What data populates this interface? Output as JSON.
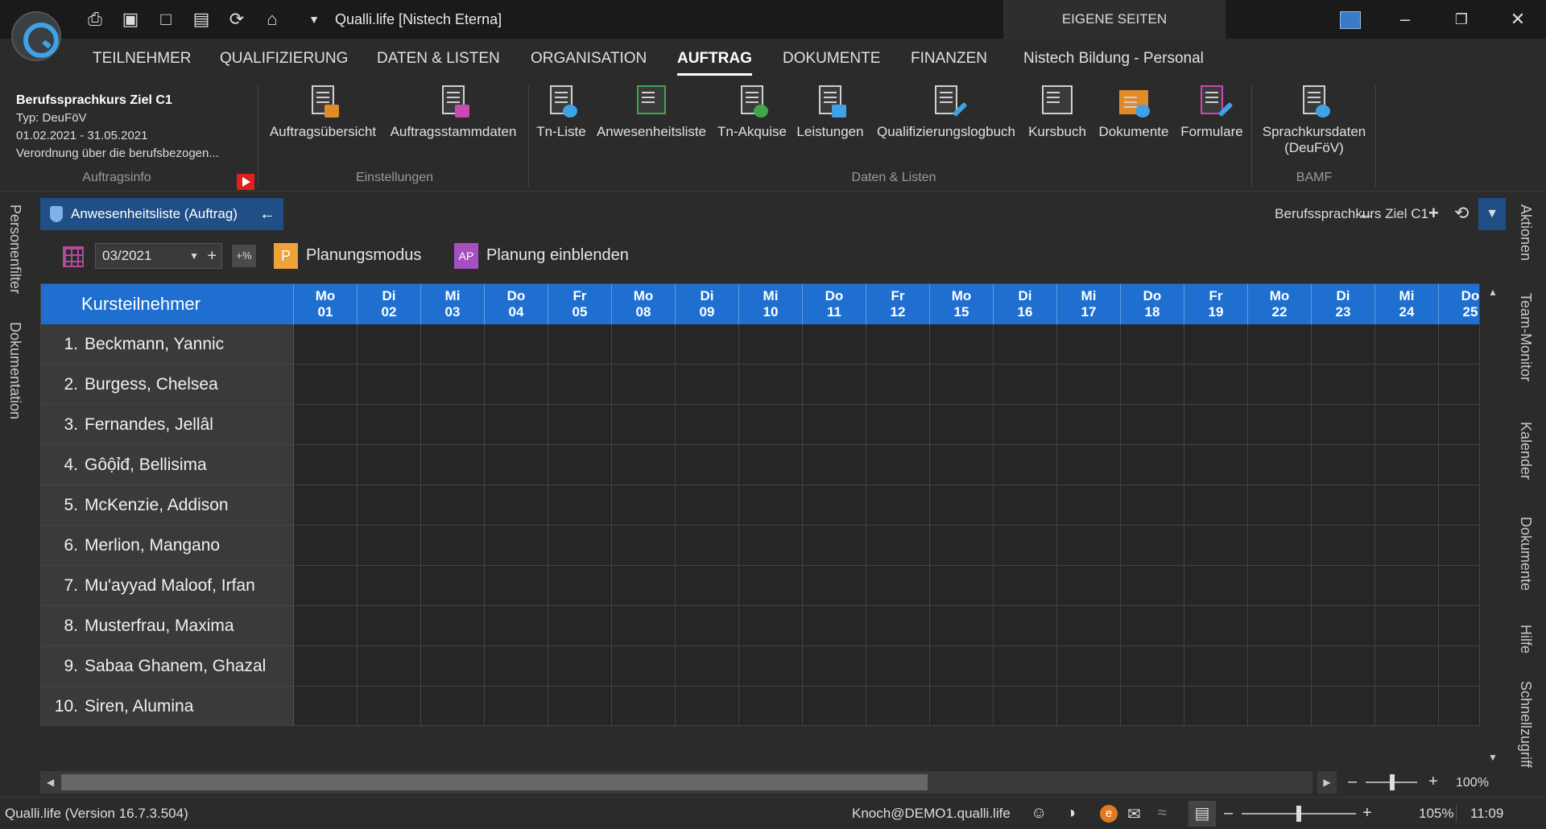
{
  "titlebar": {
    "app_title": "Qualli.life [Nistech Eterna]",
    "eigene_seiten": "EIGENE SEITEN",
    "quick_access": [
      "print-icon",
      "save-icon",
      "lock-icon",
      "report-icon",
      "refresh-icon",
      "home-icon",
      "dropdown-icon"
    ],
    "window_controls": [
      "minimize-icon",
      "restore-icon",
      "close-icon"
    ]
  },
  "ribbon_tabs": [
    "TEILNEHMER",
    "QUALIFIZIERUNG",
    "DATEN & LISTEN",
    "ORGANISATION",
    "AUFTRAG",
    "DOKUMENTE",
    "FINANZEN",
    "Nistech Bildung - Personal"
  ],
  "active_tab": "AUFTRAG",
  "auftragsinfo": {
    "title": "Berufssprachkurs Ziel C1",
    "typ": "Typ: DeuFöV",
    "dates": "01.02.2021 - 31.05.2021",
    "verordnung": "Verordnung über die berufsbezogen...",
    "group_label": "Auftragsinfo"
  },
  "ribbon_groups": {
    "einstellungen": {
      "label": "Einstellungen",
      "buttons": [
        "Auftragsübersicht",
        "Auftragsstammdaten"
      ]
    },
    "daten_listen": {
      "label": "Daten & Listen",
      "buttons": [
        "Tn-Liste",
        "Anwesenheitsliste",
        "Tn-Akquise",
        "Leistungen",
        "Qualifizierungslogbuch",
        "Kursbuch",
        "Dokumente",
        "Formulare"
      ]
    },
    "bamf": {
      "label": "BAMF",
      "button_line1": "Sprachkursdaten",
      "button_line2": "(DeuFöV)"
    }
  },
  "left_sidebar": [
    "Personenfilter",
    "Dokumentation"
  ],
  "right_sidebar": [
    "Aktionen",
    "Team-Monitor",
    "Kalender",
    "Dokumente",
    "Hilfe",
    "Schnellzugriff"
  ],
  "doc_tab": {
    "label": "Anwesenheitsliste (Auftrag)",
    "breadcrumb": "Berufssprachkurs Ziel C1"
  },
  "toolbar": {
    "month": "03/2021",
    "pct_label": "+%",
    "plan_tag": "P",
    "plan_label": "Planungsmodus",
    "show_tag": "AP",
    "show_label": "Planung einblenden"
  },
  "grid": {
    "header_name": "Kursteilnehmer",
    "days": [
      {
        "dow": "Mo",
        "day": "01"
      },
      {
        "dow": "Di",
        "day": "02"
      },
      {
        "dow": "Mi",
        "day": "03"
      },
      {
        "dow": "Do",
        "day": "04"
      },
      {
        "dow": "Fr",
        "day": "05"
      },
      {
        "dow": "Mo",
        "day": "08"
      },
      {
        "dow": "Di",
        "day": "09"
      },
      {
        "dow": "Mi",
        "day": "10"
      },
      {
        "dow": "Do",
        "day": "11"
      },
      {
        "dow": "Fr",
        "day": "12"
      },
      {
        "dow": "Mo",
        "day": "15"
      },
      {
        "dow": "Di",
        "day": "16"
      },
      {
        "dow": "Mi",
        "day": "17"
      },
      {
        "dow": "Do",
        "day": "18"
      },
      {
        "dow": "Fr",
        "day": "19"
      },
      {
        "dow": "Mo",
        "day": "22"
      },
      {
        "dow": "Di",
        "day": "23"
      },
      {
        "dow": "Mi",
        "day": "24"
      },
      {
        "dow": "Do",
        "day": "25"
      }
    ],
    "participants": [
      {
        "num": "1.",
        "name": "Beckmann, Yannic"
      },
      {
        "num": "2.",
        "name": "Burgess, Chelsea"
      },
      {
        "num": "3.",
        "name": "Fernandes, Jellâl"
      },
      {
        "num": "4.",
        "name": "Gôộỉđ, Bellisima"
      },
      {
        "num": "5.",
        "name": "McKenzie, Addison"
      },
      {
        "num": "6.",
        "name": "Merlion, Mangano"
      },
      {
        "num": "7.",
        "name": "Mu'ayyad Maloof, Irfan"
      },
      {
        "num": "8.",
        "name": "Musterfrau, Maxima"
      },
      {
        "num": "9.",
        "name": "Sabaa Ghanem, Ghazal"
      },
      {
        "num": "10.",
        "name": "Siren, Alumina"
      }
    ]
  },
  "zoom_inner": "100%",
  "statusbar": {
    "version": "Qualli.life (Version 16.7.3.504)",
    "user": "Knoch@DEMO1.qualli.life",
    "zoom": "105%",
    "time": "11:09"
  },
  "colors": {
    "header_blue": "#1f6fd0",
    "tab_blue": "#1f4f86",
    "plan_orange": "#f0a23a",
    "show_purple": "#a64fc0"
  }
}
